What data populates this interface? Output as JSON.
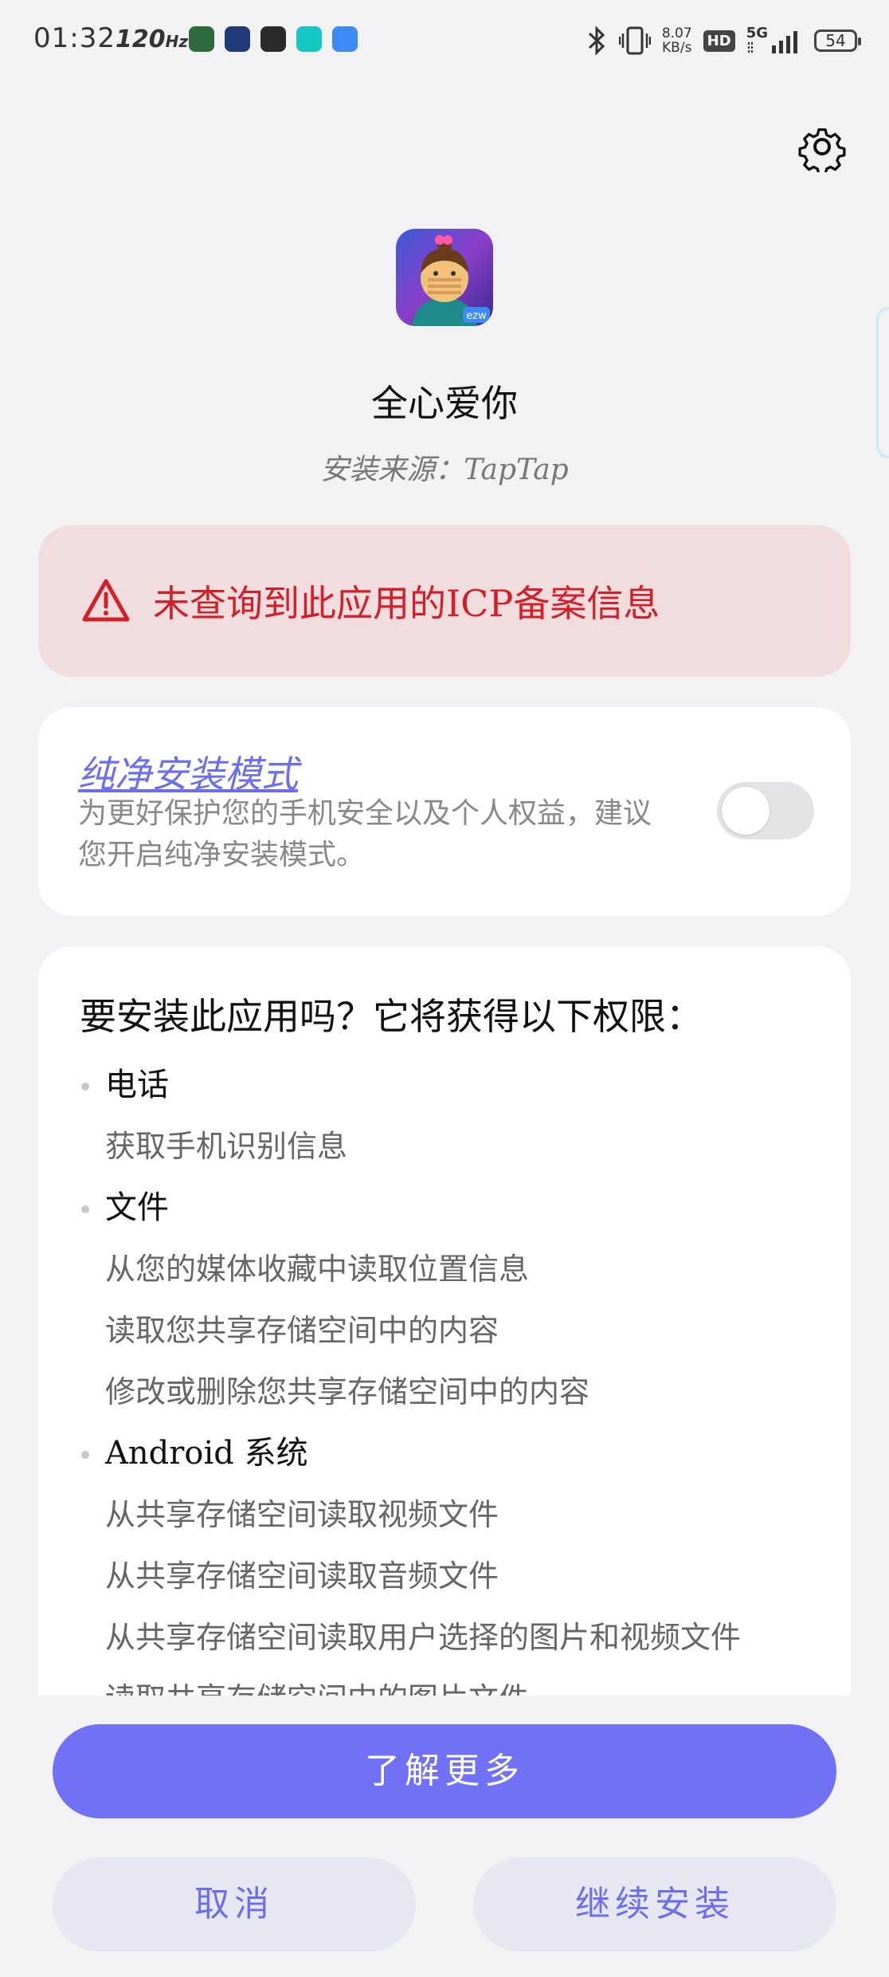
{
  "status_bar": {
    "time": "01:32",
    "refresh_rate": "120",
    "refresh_unit": "Hz",
    "net_speed_value": "8.07",
    "net_speed_unit": "KB/s",
    "hd_badge": "HD",
    "network_type": "5G",
    "battery_level": "54",
    "notification_icons": [
      "app-icon-green",
      "app-icon-blue",
      "app-icon-dark",
      "taptap-icon",
      "bracket-app-icon"
    ]
  },
  "app": {
    "name": "全心爱你",
    "source": "安装来源：TapTap",
    "icon_badge": "ezw"
  },
  "warning": {
    "text": "未查询到此应用的ICP备案信息",
    "color": "#d2202a"
  },
  "pure_mode": {
    "title": "纯净安装模式",
    "description": "为更好保护您的手机安全以及个人权益，建议您开启纯净安装模式。",
    "enabled": false
  },
  "permissions": {
    "heading": "要安装此应用吗？它将获得以下权限：",
    "groups": [
      {
        "name": "电话",
        "items": [
          "获取手机识别信息"
        ]
      },
      {
        "name": "文件",
        "items": [
          "从您的媒体收藏中读取位置信息",
          "读取您共享存储空间中的内容",
          "修改或删除您共享存储空间中的内容"
        ]
      },
      {
        "name": "Android 系统",
        "items": [
          "从共享存储空间读取视频文件",
          "从共享存储空间读取音频文件",
          "从共享存储空间读取用户选择的图片和视频文件",
          "读取共享存储空间中的图片文件"
        ]
      }
    ]
  },
  "buttons": {
    "learn_more": "了解更多",
    "cancel": "取消",
    "continue_install": "继续安装"
  },
  "colors": {
    "accent": "#7071f5",
    "background": "#f2f2f4",
    "warning_bg": "#f1dddd"
  }
}
